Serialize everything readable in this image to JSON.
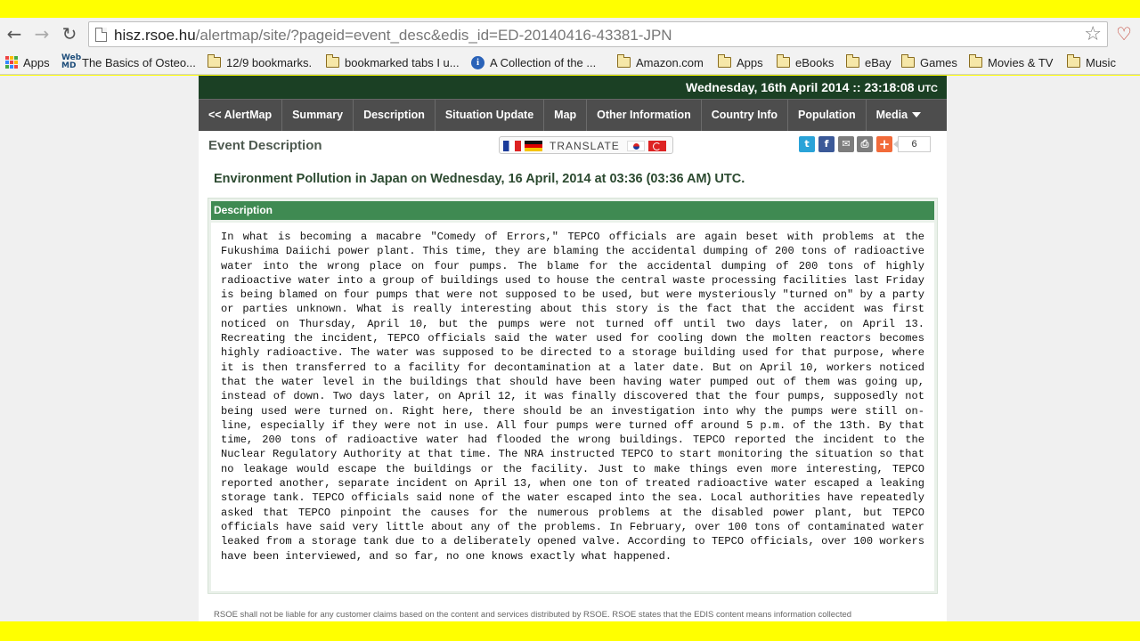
{
  "browser": {
    "url_host": "hisz.rsoe.hu",
    "url_path": "/alertmap/site/?pageid=event_desc&edis_id=ED-20140416-43381-JPN",
    "back_icon": "back-arrow-icon",
    "forward_icon": "forward-arrow-icon",
    "reload_icon": "reload-icon",
    "star_icon": "bookmark-star-icon"
  },
  "bookmarks": [
    {
      "label": "Apps",
      "icon": "apps-grid-icon"
    },
    {
      "label": "The Basics of Osteo...",
      "icon": "webmd-icon"
    },
    {
      "label": "12/9 bookmarks.",
      "icon": "folder-icon"
    },
    {
      "label": "bookmarked tabs I u...",
      "icon": "folder-icon"
    },
    {
      "label": "A Collection of the ...",
      "icon": "info-icon"
    },
    {
      "label": "Amazon.com",
      "icon": "folder-icon"
    },
    {
      "label": "Apps",
      "icon": "folder-icon"
    },
    {
      "label": "eBooks",
      "icon": "folder-icon"
    },
    {
      "label": "eBay",
      "icon": "folder-icon"
    },
    {
      "label": "Games",
      "icon": "folder-icon"
    },
    {
      "label": "Movies & TV",
      "icon": "folder-icon"
    },
    {
      "label": "Music",
      "icon": "folder-icon"
    }
  ],
  "site": {
    "datetime": "Wednesday, 16th April 2014 :: 23:18:08",
    "tz": "UTC",
    "menu": [
      "<< AlertMap",
      "Summary",
      "Description",
      "Situation Update",
      "Map",
      "Other Information",
      "Country Info",
      "Population",
      "Media"
    ],
    "section_title": "Event Description",
    "translate_label": "TRANSLATE",
    "share_count": "6",
    "headline": "Environment Pollution in Japan on Wednesday, 16 April, 2014 at 03:36 (03:36 AM) UTC.",
    "description_header": "Description",
    "description_text": "In what is becoming a macabre \"Comedy of Errors,\" TEPCO officials are again beset with problems at the Fukushima Daiichi power plant. This time, they are blaming the accidental dumping of 200 tons of radioactive water into the wrong place on four pumps. The blame for the accidental dumping of 200 tons of highly radioactive water into a group of buildings used to house the central waste processing facilities last Friday is being blamed on four pumps that were not supposed to be used, but were mysteriously \"turned on\" by a party or parties unknown. What is really interesting about this story is the fact that the accident was first noticed on Thursday, April 10, but the pumps were not turned off until two days later, on April 13. Recreating the incident, TEPCO officials said the water used for cooling down the molten reactors becomes highly radioactive. The water was supposed to be directed to a storage building used for that purpose, where it is then transferred to a facility for decontamination at a later date. But on April 10, workers noticed that the water level in the buildings that should have been having water pumped out of them was going up, instead of down. Two days later, on April 12, it was finally discovered that the four pumps, supposedly not being used were turned on. Right here, there should be an investigation into why the pumps were still on-line, especially if they were not in use. All four pumps were turned off around 5 p.m. of the 13th. By that time, 200 tons of radioactive water had flooded the wrong buildings. TEPCO reported the incident to the Nuclear Regulatory Authority at that time. The NRA instructed TEPCO to start monitoring the situation so that no leakage would escape the buildings or the facility. Just to make things even more interesting, TEPCO reported another, separate incident on April 13, when one ton of treated radioactive water escaped a leaking storage tank. TEPCO officials said none of the water escaped into the sea. Local authorities have repeatedly asked that TEPCO pinpoint the causes for the numerous problems at the disabled power plant, but TEPCO officials have said very little about any of the problems. In February, over 100 tons of contaminated water leaked from a storage tank due to a deliberately opened valve. According to TEPCO officials, over 100 workers have been interviewed, and so far, no one knows exactly what happened.",
    "disclaimer": "RSOE shall not be liable for any customer claims based on the content and services distributed by RSOE. RSOE states that the EDIS content means information collected"
  },
  "colors": {
    "frame": "#ffff00",
    "datebar": "#1b4024",
    "menu": "#4d4d4d",
    "desc_header": "#3f8a52"
  }
}
